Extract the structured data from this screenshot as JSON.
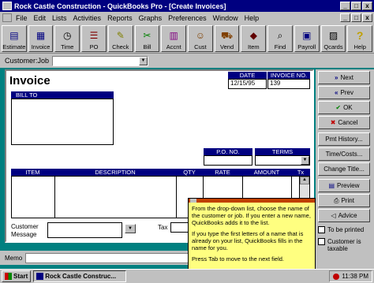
{
  "window": {
    "title": "Rock Castle Construction - QuickBooks Pro - [Create Invoices]",
    "win_controls": [
      "_",
      "□",
      "x"
    ],
    "doc_controls": [
      "_",
      "□",
      "x"
    ]
  },
  "menu": [
    "File",
    "Edit",
    "Lists",
    "Activities",
    "Reports",
    "Graphs",
    "Preferences",
    "Window",
    "Help"
  ],
  "toolbar": [
    {
      "label": "Estimate",
      "icon": "estimate-icon",
      "glyph": "▤"
    },
    {
      "label": "Invoice",
      "icon": "invoice-icon",
      "glyph": "▦"
    },
    {
      "label": "Time",
      "icon": "clock-icon",
      "glyph": "◷"
    },
    {
      "label": "PO",
      "icon": "purchase-order-icon",
      "glyph": "☰"
    },
    {
      "label": "Check",
      "icon": "check-pen-icon",
      "glyph": "✎"
    },
    {
      "label": "Bill",
      "icon": "bill-icon",
      "glyph": "✂"
    },
    {
      "label": "Accnt",
      "icon": "accounts-icon",
      "glyph": "▥"
    },
    {
      "label": "Cust",
      "icon": "customer-icon",
      "glyph": "☺"
    },
    {
      "label": "Vend",
      "icon": "vendor-icon",
      "glyph": "⛟"
    },
    {
      "label": "Item",
      "icon": "item-icon",
      "glyph": "◆"
    },
    {
      "label": "Find",
      "icon": "find-icon",
      "glyph": "⌕"
    },
    {
      "label": "Payroll",
      "icon": "payroll-icon",
      "glyph": "▣"
    },
    {
      "label": "Qcards",
      "icon": "qcards-icon",
      "glyph": "▨"
    },
    {
      "label": "Help",
      "icon": "help-icon",
      "glyph": "?"
    }
  ],
  "customer_job": {
    "label": "Customer:Job",
    "value": ""
  },
  "invoice": {
    "title": "Invoice",
    "date_label": "DATE",
    "date_value": "12/15/95",
    "invoice_no_label": "INVOICE NO.",
    "invoice_no_value": "139",
    "bill_to_label": "BILL TO",
    "po_no_label": "P.O. NO.",
    "terms_label": "TERMS",
    "columns": [
      "ITEM",
      "DESCRIPTION",
      "QTY",
      "RATE",
      "AMOUNT",
      "Tx"
    ],
    "customer_message_label": "Customer Message",
    "tax_label": "Tax"
  },
  "memo_label": "Memo",
  "buttons": [
    {
      "label": "Next",
      "glyph": "»"
    },
    {
      "label": "Prev",
      "glyph": "«"
    },
    {
      "label": "OK",
      "glyph": "✔"
    },
    {
      "label": "Cancel",
      "glyph": "✖"
    },
    {
      "label": "Pmt History...",
      "glyph": ""
    },
    {
      "label": "Time/Costs...",
      "glyph": ""
    },
    {
      "label": "Change Title...",
      "glyph": ""
    },
    {
      "label": "Preview",
      "glyph": "▤"
    },
    {
      "label": "Print",
      "glyph": "⎙"
    },
    {
      "label": "Advice",
      "glyph": "◁"
    }
  ],
  "checkboxes": [
    {
      "label": "To be printed"
    },
    {
      "label": "Customer is taxable"
    }
  ],
  "tooltip": {
    "para1": "From the drop-down list, choose the name of the customer or job. If you enter a new name, QuickBooks adds it to the list.",
    "para2": "If you type the first letters of a name that is already on your list, QuickBooks fills in the name for you.",
    "para3": "Press Tab to move to the next field."
  },
  "taskbar": {
    "start": "Start",
    "task": "Rock Castle Construc...",
    "clock": "11:38 PM"
  },
  "colors": {
    "titlebar": "#000080",
    "face": "#c0c0c0",
    "desktop": "#008080",
    "tooltip": "#ffff80",
    "header": "#000080"
  }
}
